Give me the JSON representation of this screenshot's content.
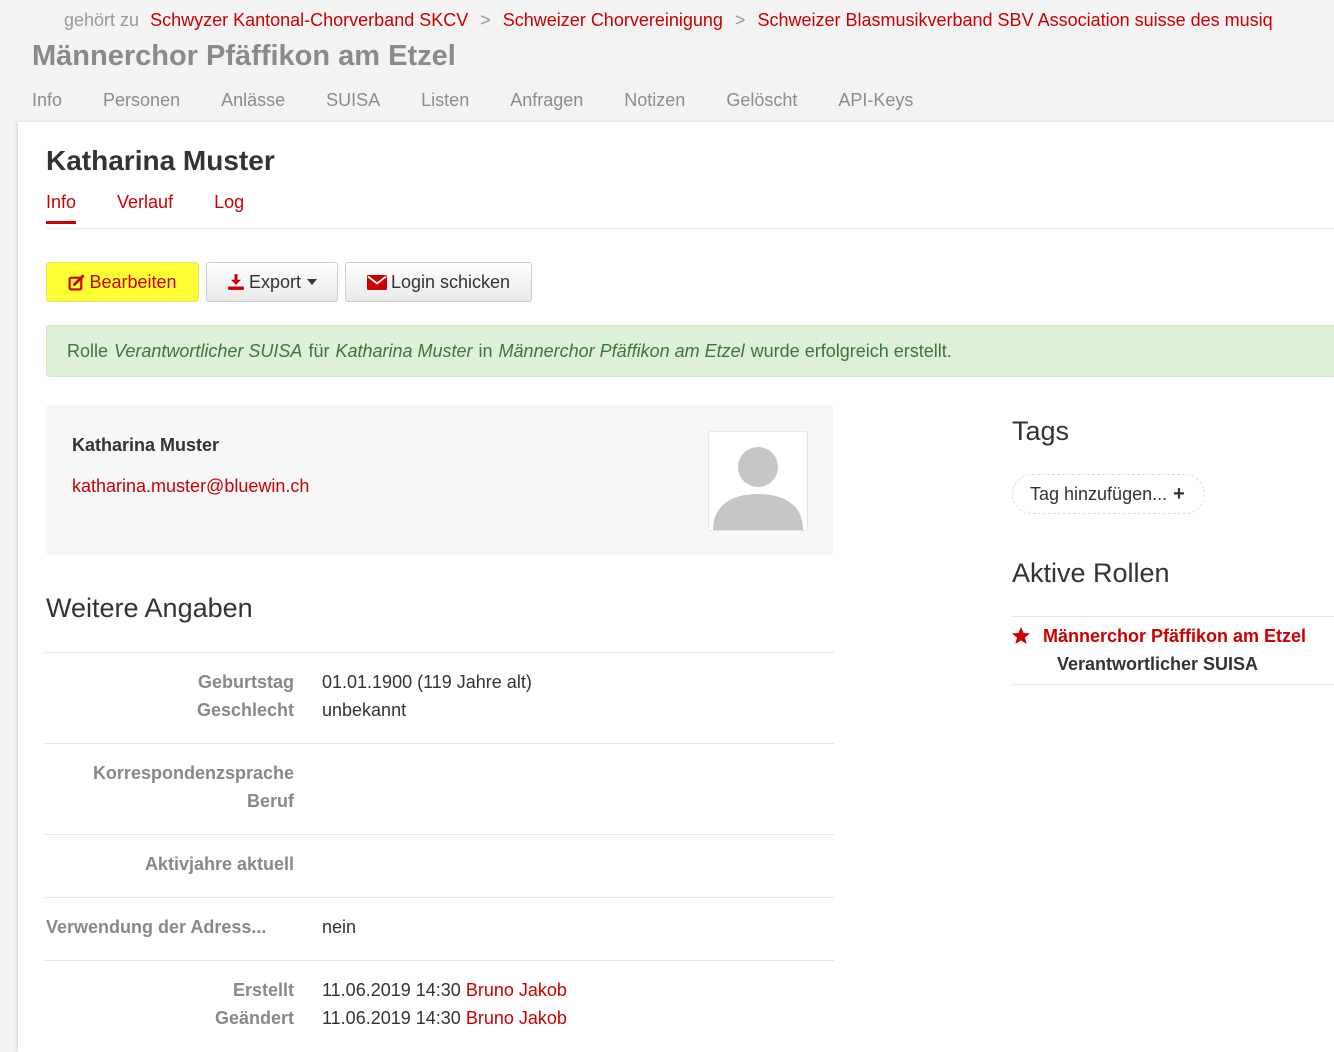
{
  "breadcrumb": {
    "prefix": "gehört zu",
    "items": [
      "Schwyzer Kantonal-Chorverband SKCV",
      "Schweizer Chorvereinigung",
      "Schweizer Blasmusikverband SBV Association suisse des musiq"
    ],
    "separator": ">"
  },
  "group": {
    "title": "Männerchor Pfäffikon am Etzel",
    "tabs": [
      "Info",
      "Personen",
      "Anlässe",
      "SUISA",
      "Listen",
      "Anfragen",
      "Notizen",
      "Gelöscht",
      "API-Keys"
    ]
  },
  "person": {
    "name": "Katharina Muster",
    "tabs": [
      "Info",
      "Verlauf",
      "Log"
    ],
    "active_tab": "Info",
    "email": "katharina.muster@bluewin.ch"
  },
  "actions": {
    "edit_label": "Bearbeiten",
    "export_label": "Export",
    "login_label": "Login schicken"
  },
  "alert": {
    "part1": "Rolle",
    "role": "Verantwortlicher SUISA",
    "part2": "für",
    "person": "Katharina Muster",
    "part3": "in",
    "group": "Männerchor Pfäffikon am Etzel",
    "part4": "wurde erfolgreich erstellt."
  },
  "details": {
    "title": "Weitere Angaben",
    "birthday_label": "Geburtstag",
    "birthday_value": "01.01.1900 (119 Jahre alt)",
    "gender_label": "Geschlecht",
    "gender_value": "unbekannt",
    "language_label": "Korrespondenzsprache",
    "job_label": "Beruf",
    "active_years_label": "Aktivjahre aktuell",
    "address_usage_label": "Verwendung der Adress...",
    "address_usage_value": "nein",
    "created_label": "Erstellt",
    "created_value": "11.06.2019 14:30",
    "created_by": "Bruno Jakob",
    "changed_label": "Geändert",
    "changed_value": "11.06.2019 14:30",
    "changed_by": "Bruno Jakob"
  },
  "tags": {
    "title": "Tags",
    "add_label": "Tag hinzufügen..."
  },
  "roles": {
    "title": "Aktive Rollen",
    "group": "Männerchor Pfäffikon am Etzel",
    "role": "Verantwortlicher SUISA"
  },
  "colors": {
    "accent": "#cc0000",
    "highlight": "#ffff36",
    "success_bg": "#def0d8"
  }
}
